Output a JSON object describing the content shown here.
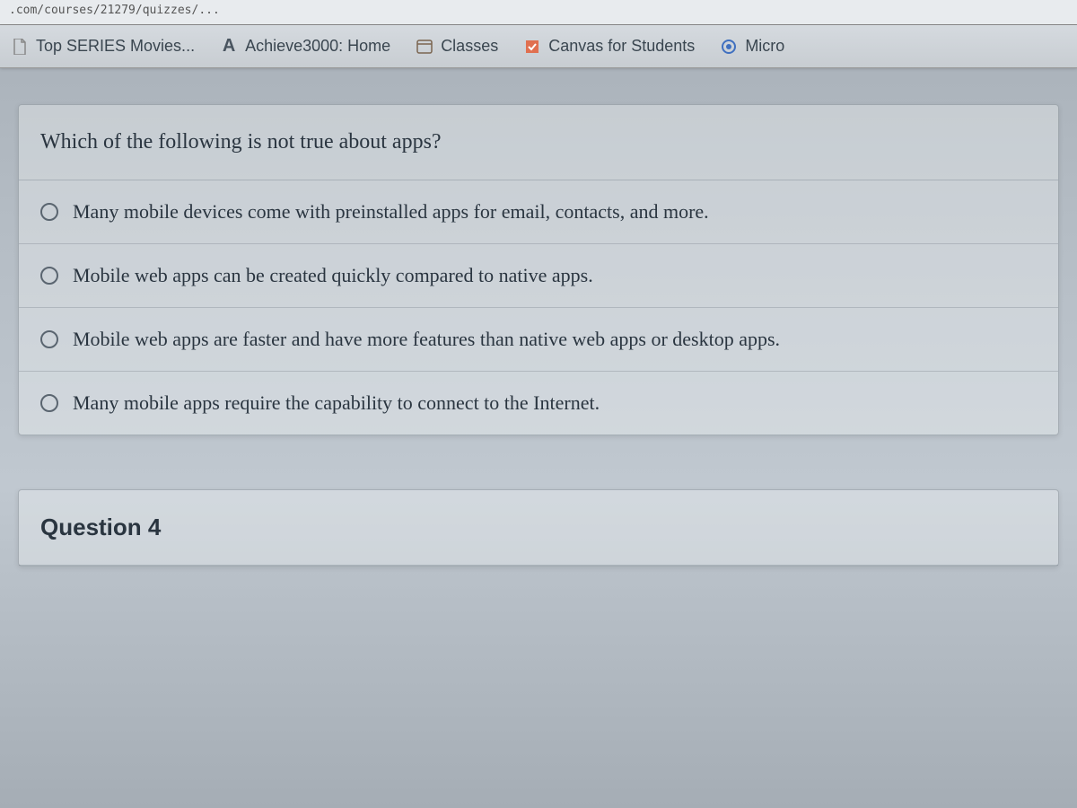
{
  "address_bar": {
    "url_fragment": ".com/courses/21279/quizzes/..."
  },
  "bookmarks": [
    {
      "label": "Top SERIES Movies...",
      "icon": "page-icon"
    },
    {
      "label": "Achieve3000: Home",
      "icon": "a-icon"
    },
    {
      "label": "Classes",
      "icon": "classes-icon"
    },
    {
      "label": "Canvas for Students",
      "icon": "canvas-icon"
    },
    {
      "label": "Micro",
      "icon": "micro-icon"
    }
  ],
  "quiz": {
    "question_text": "Which of the following is not true about apps?",
    "options": [
      "Many mobile devices come with preinstalled apps for email, contacts, and more.",
      "Mobile web apps can be created quickly compared to native apps.",
      "Mobile web apps are faster and have more features than native web apps or desktop apps.",
      "Many mobile apps require the capability to connect to the Internet."
    ],
    "next_question_label": "Question 4"
  }
}
